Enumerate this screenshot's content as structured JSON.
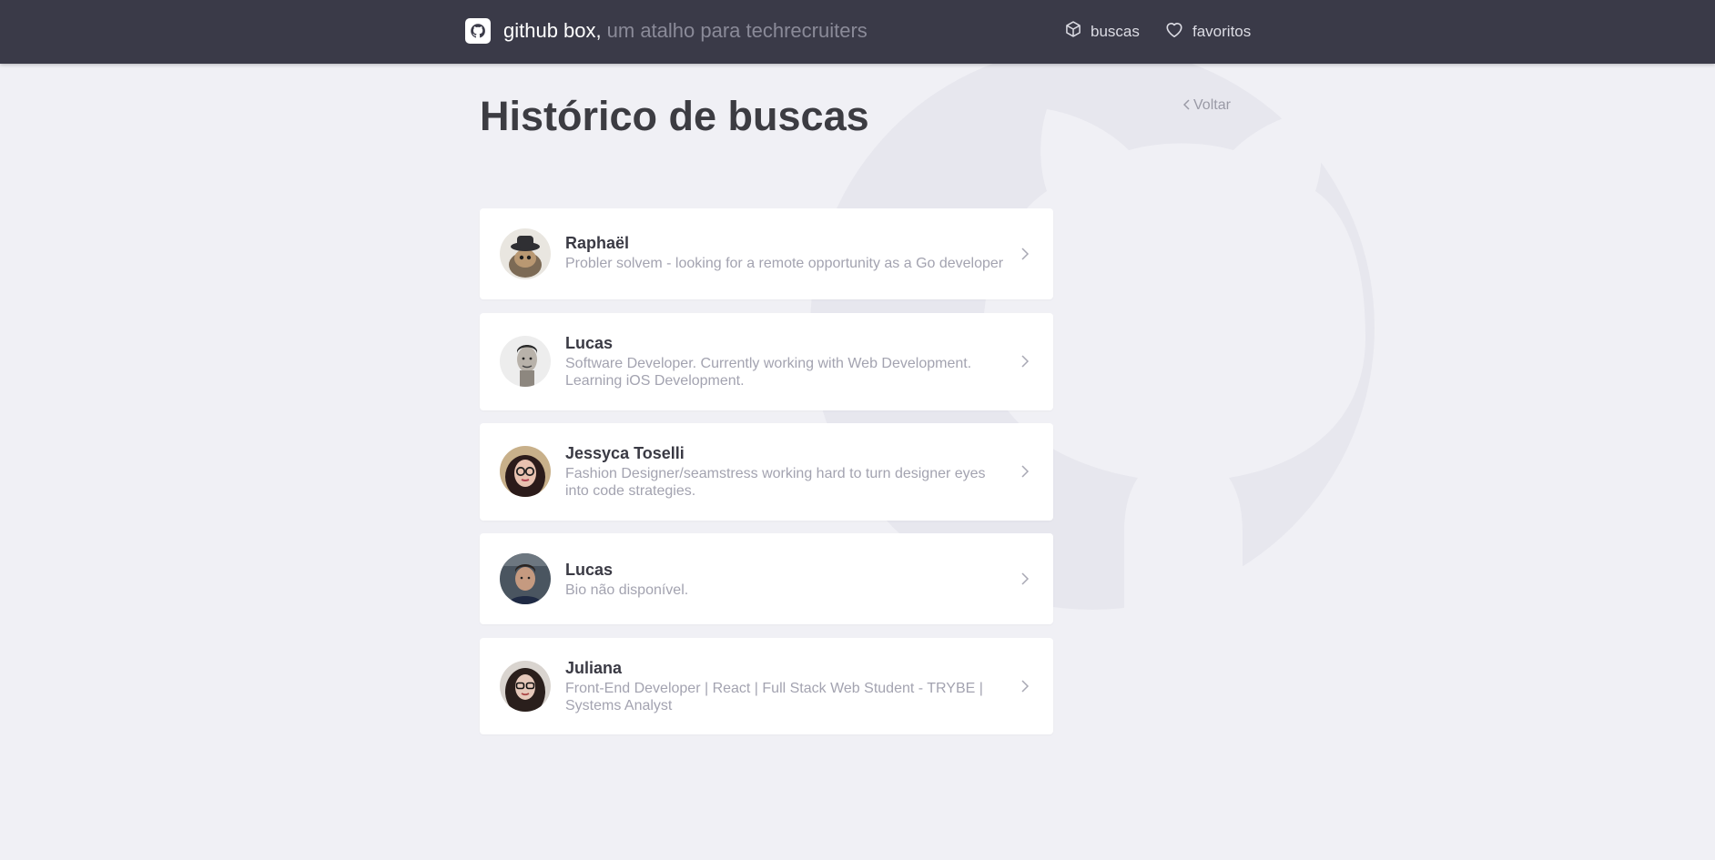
{
  "header": {
    "brand_name": "github box,",
    "brand_tagline": "um atalho para techrecruiters",
    "nav": {
      "buscas": "buscas",
      "favoritos": "favoritos"
    }
  },
  "page": {
    "title": "Histórico de buscas",
    "back_label": "Voltar"
  },
  "history": [
    {
      "name": "Raphaël",
      "bio": "Probler solvem - looking for a remote opportunity as a Go developer"
    },
    {
      "name": "Lucas",
      "bio": "Software Developer. Currently working with Web Development. Learning iOS Development."
    },
    {
      "name": "Jessyca Toselli",
      "bio": "Fashion Designer/seamstress working hard to turn designer eyes into code strategies."
    },
    {
      "name": "Lucas",
      "bio": "Bio não disponível."
    },
    {
      "name": "Juliana",
      "bio": "Front-End Developer | React | Full Stack Web Student - TRYBE | Systems Analyst"
    }
  ],
  "colors": {
    "header_bg": "#3a3a48",
    "page_bg": "#f0f0f5",
    "title": "#3c3c42",
    "muted": "#a3a3b0"
  },
  "icons": {
    "brand": "github-icon",
    "buscas": "cube-icon",
    "favoritos": "heart-icon",
    "back": "chevron-left-icon",
    "row": "chevron-right-icon"
  }
}
